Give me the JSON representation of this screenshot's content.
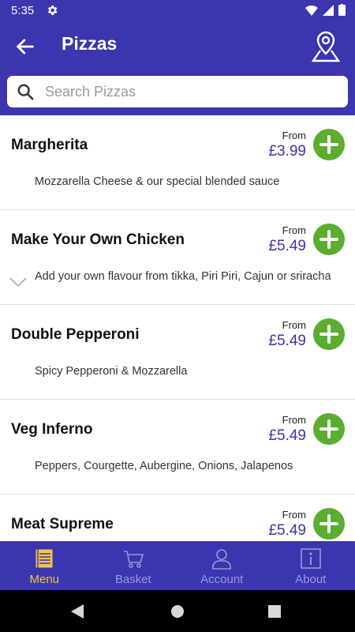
{
  "status": {
    "time": "5:35"
  },
  "appbar": {
    "title": "Pizzas"
  },
  "search": {
    "placeholder": "Search Pizzas"
  },
  "items": [
    {
      "name": "Margherita",
      "from": "From",
      "price": "£3.99",
      "desc": "Mozzarella Cheese & our special blended sauce",
      "expandable": false
    },
    {
      "name": "Make Your Own Chicken",
      "from": "From",
      "price": "£5.49",
      "desc": "Add your own flavour from tikka, Piri Piri, Cajun or sriracha",
      "expandable": true
    },
    {
      "name": "Double Pepperoni",
      "from": "From",
      "price": "£5.49",
      "desc": "Spicy Pepperoni & Mozzarella",
      "expandable": false
    },
    {
      "name": "Veg Inferno",
      "from": "From",
      "price": "£5.49",
      "desc": "Peppers, Courgette, Aubergine, Onions, Jalapenos",
      "expandable": false
    },
    {
      "name": "Meat Supreme",
      "from": "From",
      "price": "£5.49",
      "desc": "",
      "expandable": false
    }
  ],
  "nav": [
    {
      "label": "Menu",
      "icon": "menu-book-icon",
      "active": true
    },
    {
      "label": "Basket",
      "icon": "basket-cart-icon",
      "active": false
    },
    {
      "label": "Account",
      "icon": "account-person-icon",
      "active": false
    },
    {
      "label": "About",
      "icon": "about-info-icon",
      "active": false
    }
  ],
  "colors": {
    "primary": "#3b35b0",
    "add": "#5aad2e",
    "active": "#f5c542",
    "inactive": "#9c98d8"
  }
}
